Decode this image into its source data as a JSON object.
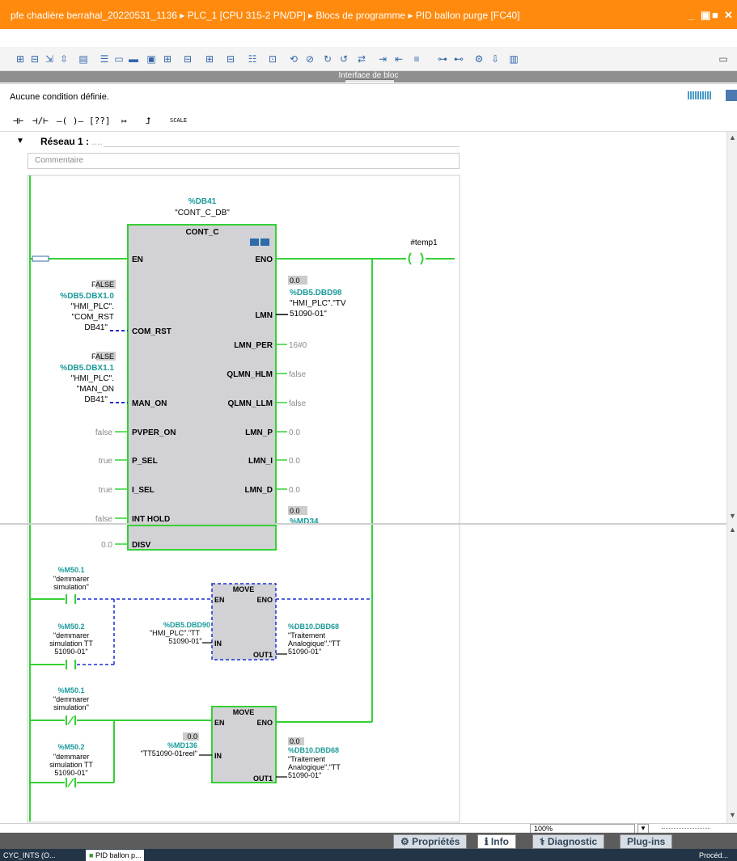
{
  "window": {
    "title": "pfe chadière berrahal_20220531_1136 ▸ PLC_1 [CPU 315-2 PN/DP] ▸ Blocs de programme ▸ PID ballon purge [FC40]",
    "controls": [
      "_",
      "▣",
      "■",
      "✕"
    ]
  },
  "interface_bar": "Interface de bloc",
  "condition_text": "Aucune condition définie.",
  "ladder_toolbar": {
    "no_contact": "⊣⊢",
    "nc_contact": "⊣/⊢",
    "coil": "–( )–",
    "empty_box": "[??]",
    "open_branch": "↦",
    "close_branch": "⮥",
    "scale": "SCALE"
  },
  "network": {
    "label": "Réseau 1 :",
    "dots": "....",
    "comment_placeholder": "Commentaire"
  },
  "pid": {
    "db_addr": "%DB41",
    "db_name": "\"CONT_C_DB\"",
    "type": "CONT_C",
    "inputs": [
      "EN",
      "COM_RST",
      "MAN_ON",
      "PVPER_ON",
      "P_SEL",
      "I_SEL",
      "INT HOLD",
      "DISV"
    ],
    "outputs": [
      "ENO",
      "LMN",
      "LMN_PER",
      "QLMN_HLM",
      "QLMN_LLM",
      "LMN_P",
      "LMN_I",
      "LMN_D"
    ],
    "com_rst": {
      "val": "FALSE",
      "addr": "%DB5.DBX1.0",
      "name1": "\"HMI_PLC\".",
      "name2": "\"COM_RST",
      "name3": "DB41\""
    },
    "man_on": {
      "val": "FALSE",
      "addr": "%DB5.DBX1.1",
      "name1": "\"HMI_PLC\".",
      "name2": "\"MAN_ON",
      "name3": "DB41\""
    },
    "pvper_on": "false",
    "p_sel": "true",
    "i_sel": "true",
    "int_hold": "false",
    "disv": "0.0",
    "lmn": {
      "val": "0.0",
      "addr": "%DB5.DBD98",
      "name1": "\"HMI_PLC\".\"TV",
      "name2": "51090-01\""
    },
    "lmn_per": "16#0",
    "qlmn_hlm": "false",
    "qlmn_llm": "false",
    "lmn_p": "0.0",
    "lmn_i": "0.0",
    "lmn_d": "0.0",
    "extra_val": "0.0",
    "extra_addr": "%MD34",
    "coil_label": "#temp1"
  },
  "move1": {
    "type": "MOVE",
    "en": "EN",
    "eno": "ENO",
    "in": "IN",
    "out": "OUT1",
    "in_addr": "%DB5.DBD90",
    "in_name1": "\"HMI_PLC\".\"TT",
    "in_name2": "51090-01\"",
    "out_addr": "%DB10.DBD68",
    "out_name1": "\"Traitement",
    "out_name2": "Analogique\".\"TT",
    "out_name3": "51090-01\""
  },
  "move2": {
    "type": "MOVE",
    "en": "EN",
    "eno": "ENO",
    "in": "IN",
    "out": "OUT1",
    "in_val": "0.0",
    "in_addr": "%MD136",
    "in_name": "\"TT51090-01reel\"",
    "out_val": "0.0",
    "out_addr": "%DB10.DBD68",
    "out_name1": "\"Traitement",
    "out_name2": "Analogique\".\"TT",
    "out_name3": "51090-01\""
  },
  "contacts": {
    "m501_a": {
      "addr": "%M50.1",
      "name1": "\"demmarer",
      "name2": "simulation\""
    },
    "m502_a": {
      "addr": "%M50.2",
      "name1": "\"demmarer",
      "name2": "simulation TT",
      "name3": "51090-01\""
    },
    "m501_b": {
      "addr": "%M50.1",
      "name1": "\"demmarer",
      "name2": "simulation\""
    },
    "m502_b": {
      "addr": "%M50.2",
      "name1": "\"demmarer",
      "name2": "simulation TT",
      "name3": "51090-01\""
    }
  },
  "zoom": {
    "value": "100%"
  },
  "bottom_tabs": {
    "proprietes": "Propriétés",
    "info": "Info",
    "diagnostic": "Diagnostic",
    "plugins": "Plug-ins"
  },
  "taskbar": {
    "item1": "CYC_INTS (O...",
    "item2": "PID ballon p...",
    "item3": "Procéd..."
  },
  "colors": {
    "title_bg": "#ff8a0e",
    "rung_green": "#35d035",
    "address_teal": "#1a9a9a",
    "dashed_blue": "#1a2fd0",
    "block_fill": "#d2d2d6"
  }
}
